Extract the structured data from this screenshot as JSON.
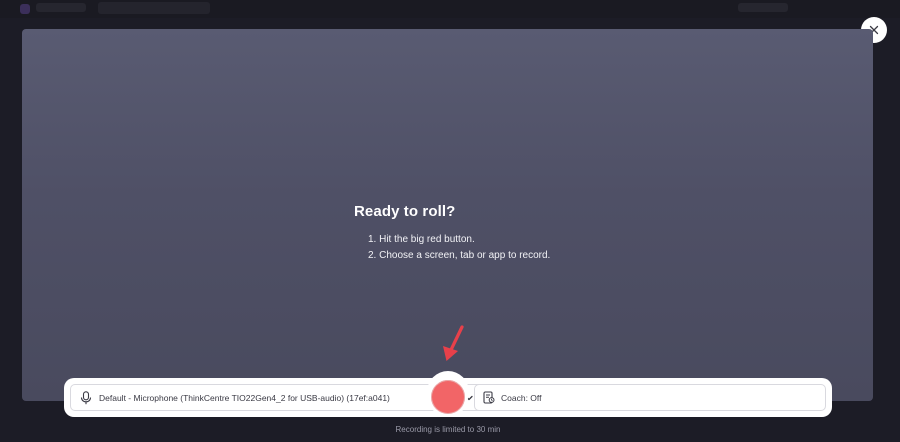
{
  "preview": {
    "title": "Ready to roll?",
    "steps": [
      "1. Hit the big red button.",
      "2. Choose a screen, tab or app to record."
    ]
  },
  "controls": {
    "microphone_label": "Default - Microphone (ThinkCentre TIO22Gen4_2 for USB-audio) (17ef:a041)",
    "coach_label": "Coach: Off",
    "record_color": "#f26567"
  },
  "footer": {
    "limit_text": "Recording is limited to 30 min"
  },
  "icons": {
    "close": "close-icon",
    "microphone": "microphone-icon",
    "dropdown": "chevron-down-icon",
    "coach": "coach-icon",
    "arrow": "arrow-pointer-icon"
  },
  "colors": {
    "accent_red": "#f26567",
    "arrow_red": "#e8404a",
    "preview_bg": "#535469"
  }
}
